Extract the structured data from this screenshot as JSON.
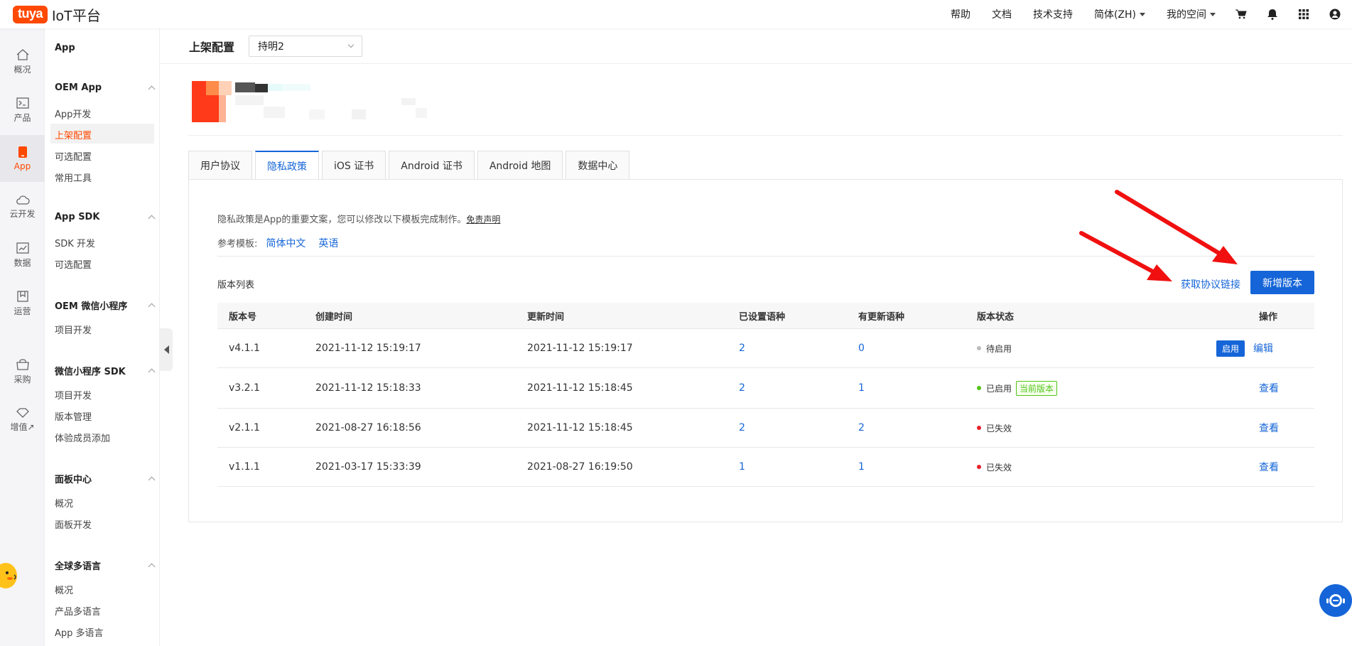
{
  "topbar": {
    "logo_badge": "tuya",
    "logo_text": "IoT平台",
    "nav": [
      "帮助",
      "文档",
      "技术支持"
    ],
    "language": "简体(ZH)",
    "space": "我的空间"
  },
  "rail": {
    "items": [
      {
        "label": "概况",
        "icon": "home-icon"
      },
      {
        "label": "产品",
        "icon": "terminal-icon"
      },
      {
        "label": "App",
        "icon": "phone-icon"
      },
      {
        "label": "云开发",
        "icon": "cloud-icon"
      },
      {
        "label": "数据",
        "icon": "chart-icon"
      },
      {
        "label": "运营",
        "icon": "bookmark-icon"
      },
      {
        "label": "采购",
        "icon": "shop-icon"
      },
      {
        "label": "增值↗",
        "icon": "diamond-icon"
      }
    ]
  },
  "sidebar": {
    "title": "App",
    "groups": [
      {
        "label": "OEM App",
        "items": [
          "App开发",
          "上架配置",
          "可选配置",
          "常用工具"
        ]
      },
      {
        "label": "App SDK",
        "items": [
          "SDK 开发",
          "可选配置"
        ]
      },
      {
        "label": "OEM 微信小程序",
        "items": [
          "项目开发"
        ]
      },
      {
        "label": "微信小程序 SDK",
        "items": [
          "项目开发",
          "版本管理",
          "体验成员添加"
        ]
      },
      {
        "label": "面板中心",
        "items": [
          "概况",
          "面板开发"
        ]
      },
      {
        "label": "全球多语言",
        "items": [
          "概况",
          "产品多语言",
          "App 多语言"
        ]
      }
    ]
  },
  "header": {
    "title": "上架配置",
    "app_select": "持明2"
  },
  "tabs": [
    "用户协议",
    "隐私政策",
    "iOS 证书",
    "Android 证书",
    "Android 地图",
    "数据中心"
  ],
  "content": {
    "description": "隐私政策是App的重要文案，您可以修改以下模板完成制作。",
    "disclaimer": "免责声明",
    "template_label": "参考模板:",
    "template_links": [
      "简体中文",
      "英语"
    ],
    "list_title": "版本列表",
    "get_link": "获取协议链接",
    "new_version": "新增版本"
  },
  "table": {
    "headers": [
      "版本号",
      "创建时间",
      "更新时间",
      "已设置语种",
      "有更新语种",
      "版本状态",
      "操作"
    ],
    "rows": [
      {
        "version": "v4.1.1",
        "created": "2021-11-12 15:19:17",
        "updated": "2021-11-12 15:19:17",
        "set": "2",
        "upd": "0",
        "status": "待启用",
        "tag": "",
        "enable": "启用",
        "op": "编辑"
      },
      {
        "version": "v3.2.1",
        "created": "2021-11-12 15:18:33",
        "updated": "2021-11-12 15:18:45",
        "set": "2",
        "upd": "1",
        "status": "已启用",
        "tag": "当前版本",
        "enable": "",
        "op": "查看"
      },
      {
        "version": "v2.1.1",
        "created": "2021-08-27 16:18:56",
        "updated": "2021-11-12 15:18:45",
        "set": "2",
        "upd": "2",
        "status": "已失效",
        "tag": "",
        "enable": "",
        "op": "查看"
      },
      {
        "version": "v1.1.1",
        "created": "2021-03-17 15:33:39",
        "updated": "2021-08-27 16:19:50",
        "set": "1",
        "upd": "1",
        "status": "已失效",
        "tag": "",
        "enable": "",
        "op": "查看"
      }
    ]
  },
  "colors": {
    "accent": "#1565d8",
    "brand": "#ff4800",
    "pending": "#bbbbbb",
    "active": "#52c41a",
    "expired": "#e8202a",
    "arrow": "#f01010"
  }
}
